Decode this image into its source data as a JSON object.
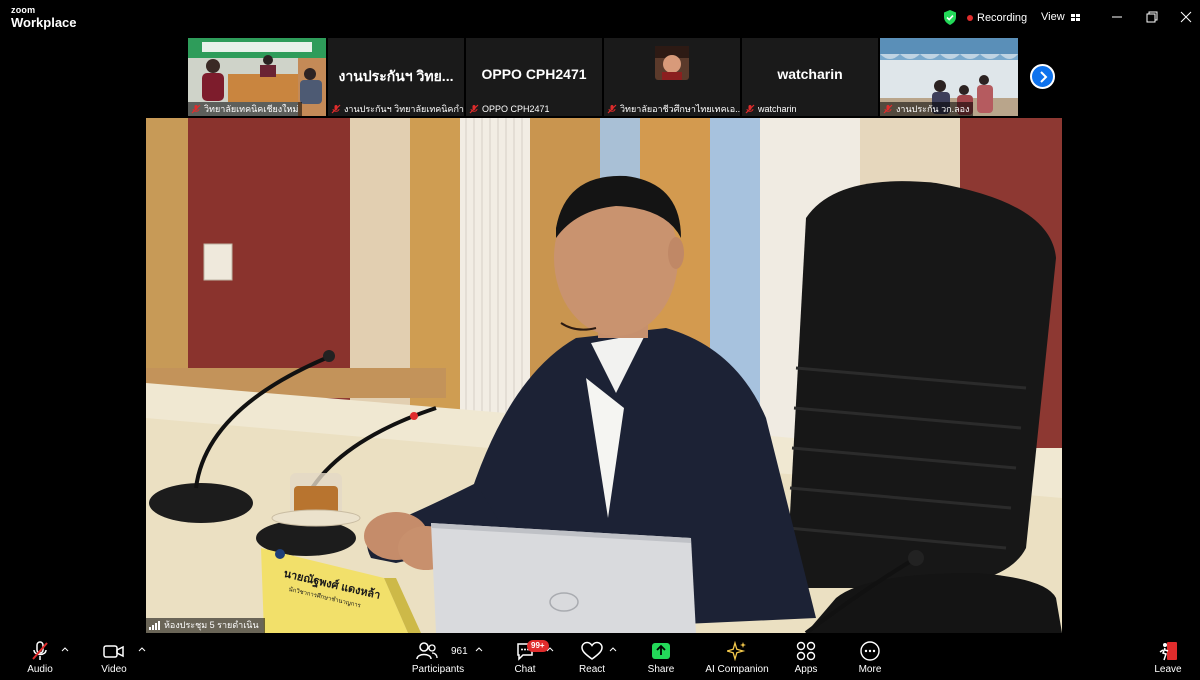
{
  "app": {
    "brand_small": "zoom",
    "brand_big": "Workplace"
  },
  "header": {
    "recording_label": "Recording",
    "view_label": "View"
  },
  "participants_strip": [
    {
      "name": "วิทยาลัยเทคนิคเชียงใหม่",
      "type": "video",
      "muted": true
    },
    {
      "name": "งานประกันฯ วิทยาลัยเทคนิคกำ...",
      "display": "งานประกันฯ วิทย...",
      "type": "name",
      "muted": true
    },
    {
      "name": "OPPO CPH2471",
      "display": "OPPO CPH2471",
      "type": "name",
      "muted": true
    },
    {
      "name": "วิทยาลัยอาชีวศึกษาไทยเทคเอ...",
      "type": "avatar",
      "muted": true
    },
    {
      "name": "watcharin",
      "display": "watcharin",
      "type": "name",
      "muted": true
    },
    {
      "name": "งานประกัน วก.ลอง",
      "type": "video",
      "muted": true
    }
  ],
  "main_video": {
    "room_label": "ห้องประชุม 5 รายดำเนิน",
    "nameplate_name": "นายณัฐพงศ์ แดงหล้า",
    "nameplate_title": "นักวิชาการศึกษาชำนาญการ"
  },
  "toolbar": {
    "audio": "Audio",
    "video": "Video",
    "participants": "Participants",
    "participants_count": "961",
    "chat": "Chat",
    "chat_badge": "99+",
    "react": "React",
    "share": "Share",
    "ai": "AI Companion",
    "apps": "Apps",
    "more": "More",
    "leave": "Leave"
  },
  "colors": {
    "accent_blue": "#0e72ed",
    "share_green": "#23d959",
    "leave_red": "#e02c2c",
    "ai_gold": "#f3c84b"
  }
}
